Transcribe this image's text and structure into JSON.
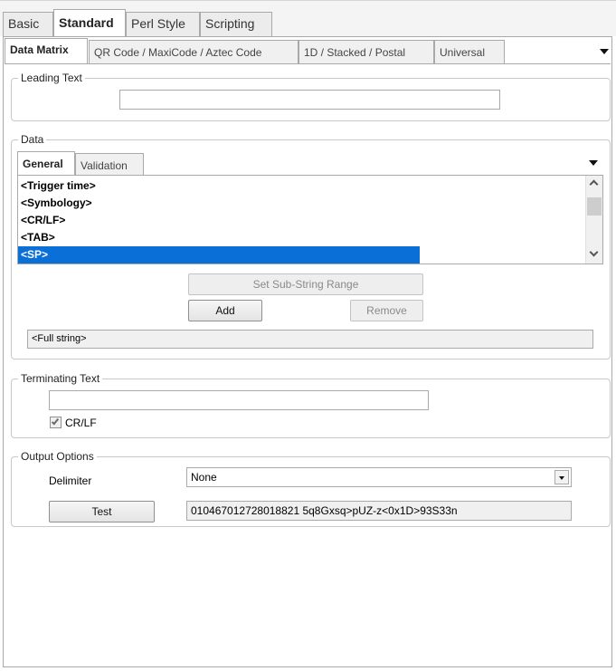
{
  "top_tabs": [
    "Basic",
    "Standard",
    "Perl Style",
    "Scripting"
  ],
  "sub_tabs": [
    "Data Matrix",
    "QR Code / MaxiCode / Aztec Code",
    "1D / Stacked / Postal",
    "Universal"
  ],
  "leading_text": {
    "legend": "Leading Text",
    "value": ""
  },
  "data": {
    "legend": "Data",
    "tabs": [
      "General",
      "Validation"
    ],
    "items": [
      "<Trigger time>",
      "<Symbology>",
      "<CR/LF>",
      "<TAB>",
      "<SP>"
    ],
    "selected_index": 4,
    "set_substring_label": "Set Sub-String Range",
    "add_label": "Add",
    "remove_label": "Remove",
    "full_string": "<Full string>"
  },
  "terminating_text": {
    "legend": "Terminating Text",
    "value": "",
    "crlf_label": "CR/LF",
    "crlf_checked": true
  },
  "output_options": {
    "legend": "Output Options",
    "delimiter_label": "Delimiter",
    "delimiter_value": "None",
    "test_label": "Test",
    "test_output": "010467012728018821 5q8Gxsq>pUZ-z<0x1D>93S33n"
  },
  "icons": {
    "dropdown": "chevron-down-icon",
    "scroll_up": "scroll-up-icon",
    "scroll_down": "scroll-down-icon",
    "check": "checkmark-icon"
  }
}
